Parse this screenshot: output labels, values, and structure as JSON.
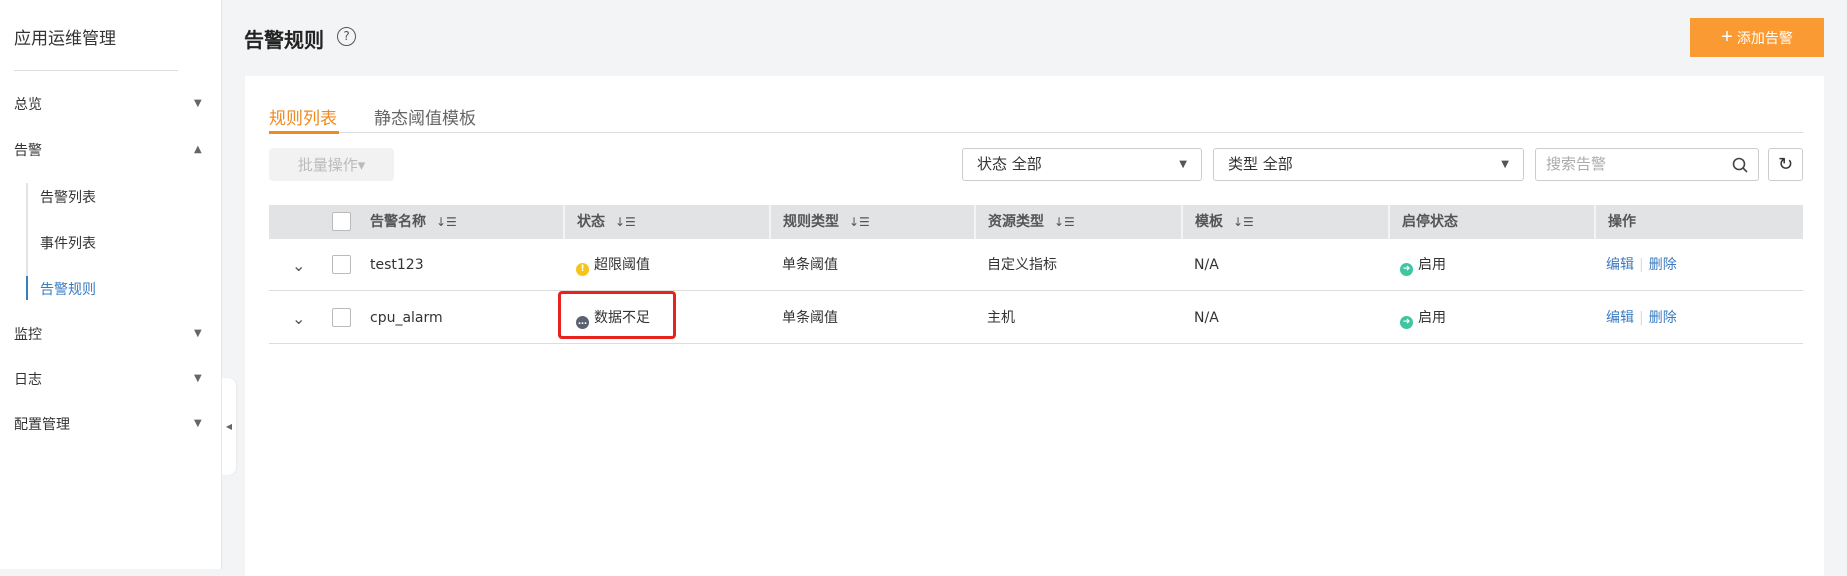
{
  "sidebar": {
    "title": "应用运维管理",
    "items": [
      {
        "label": "总览",
        "arrow": "▼"
      },
      {
        "label": "告警",
        "arrow": "▲"
      },
      {
        "label": "告警列表"
      },
      {
        "label": "事件列表"
      },
      {
        "label": "告警规则"
      },
      {
        "label": "监控",
        "arrow": "▼"
      },
      {
        "label": "日志",
        "arrow": "▼"
      },
      {
        "label": "配置管理",
        "arrow": "▼"
      }
    ]
  },
  "header": {
    "title": "告警规则",
    "help": "?",
    "add_button": "添加告警",
    "add_icon": "+"
  },
  "tabs": [
    "规则列表",
    "静态阈值模板"
  ],
  "toolbar": {
    "batch": "批量操作▾",
    "status_filter": "状态 全部",
    "type_filter": "类型 全部",
    "search_placeholder": "搜索告警"
  },
  "table": {
    "headers": [
      "告警名称",
      "状态",
      "规则类型",
      "资源类型",
      "模板",
      "启停状态",
      "操作"
    ],
    "rows": [
      {
        "name": "test123",
        "status": "超限阈值",
        "rule_type": "单条阈值",
        "resource_type": "自定义指标",
        "template": "N/A",
        "enabled": "启用",
        "edit": "编辑",
        "delete": "删除"
      },
      {
        "name": "cpu_alarm",
        "status": "数据不足",
        "rule_type": "单条阈值",
        "resource_type": "主机",
        "template": "N/A",
        "enabled": "启用",
        "edit": "编辑",
        "delete": "删除"
      }
    ]
  },
  "colors": {
    "accent": "#fa9a33",
    "link": "#3b7bc1",
    "warn": "#f5c518",
    "insufficient": "#5a6270",
    "enabled": "#3fc5a0",
    "highlight": "#e8231d"
  }
}
